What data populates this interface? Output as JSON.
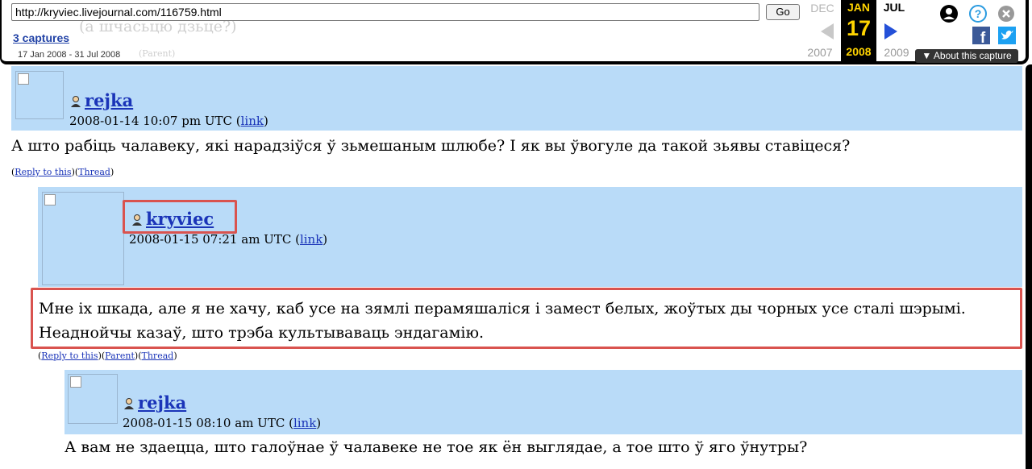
{
  "toolbar": {
    "url": "http://kryviec.livejournal.com/116759.html",
    "go_label": "Go",
    "captures_label": "3 captures",
    "date_range": "17 Jan 2008 - 31 Jul 2008",
    "prev_month": "DEC",
    "current_month": "JAN",
    "next_month": "JUL",
    "current_day": "17",
    "prev_year": "2007",
    "current_year": "2008",
    "next_year": "2009",
    "about_label": "About this capture",
    "ghost_text_1": "(а шчасьцю дзьце?)",
    "ghost_text_2": "(Parent)"
  },
  "comments": [
    {
      "username": "rejka",
      "date": "2008-01-14 10:07 pm UTC",
      "link_label": "link",
      "text": "А што рабіць чалавеку, які нарадзіўся ў зьмешаным шлюбе? І як вы ўвогуле да такой зьявы ставіцеся?",
      "reply": "Reply to this",
      "thread": "Thread"
    },
    {
      "username": "kryviec",
      "date": "2008-01-15 07:21 am UTC",
      "link_label": "link",
      "text_line1": "Мне іх шкада, але я не хачу, каб усе на зямлі перамяшаліся і замест белых, жоўтых ды чорных усе сталі шэрымі.",
      "text_line2": "Неаднойчы казаў, што трэба культываваць эндагамію.",
      "reply": "Reply to this",
      "parent": "Parent",
      "thread": "Thread"
    },
    {
      "username": "rejka",
      "date": "2008-01-15 08:10 am UTC",
      "link_label": "link",
      "text": "А вам не здаецца, што галоўнае ў чалавеке не тое як ён выглядае, а тое што ў яго ўнутры?"
    }
  ],
  "colors": {
    "comment_bg": "#b9dbf8",
    "link": "#1a34b8",
    "highlight": "#d9534f",
    "calendar_accent": "#ffd400"
  }
}
